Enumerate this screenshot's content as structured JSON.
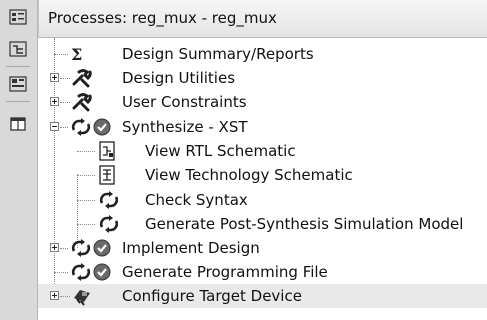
{
  "panel": {
    "title": "Processes: reg_mux - reg_mux"
  },
  "toolbar": {
    "buttons": [
      {
        "icon": "processes-icon"
      },
      {
        "icon": "hierarchy-icon"
      },
      {
        "icon": "libraries-icon"
      },
      {
        "icon": "panel-icon"
      }
    ]
  },
  "tree": {
    "items": [
      {
        "label": "Design Summary/Reports",
        "icon": "sigma-icon"
      },
      {
        "label": "Design Utilities",
        "icon": "tools-icon"
      },
      {
        "label": "User Constraints",
        "icon": "tools-icon"
      },
      {
        "label": "Synthesize - XST",
        "icon": "run-complete-icon"
      },
      {
        "label": "View RTL Schematic",
        "icon": "schematic-icon"
      },
      {
        "label": "View Technology Schematic",
        "icon": "schematic-icon"
      },
      {
        "label": "Check Syntax",
        "icon": "run-icon"
      },
      {
        "label": "Generate Post-Synthesis Simulation Model",
        "icon": "run-icon"
      },
      {
        "label": "Implement Design",
        "icon": "run-complete-icon"
      },
      {
        "label": "Generate Programming File",
        "icon": "run-complete-icon"
      },
      {
        "label": "Configure Target Device",
        "icon": "device-icon"
      }
    ]
  },
  "colors": {
    "toolbar_bg": "#d9d9d9",
    "selected_row": "#e9e9e9",
    "check_badge": "#6a6a6a"
  }
}
